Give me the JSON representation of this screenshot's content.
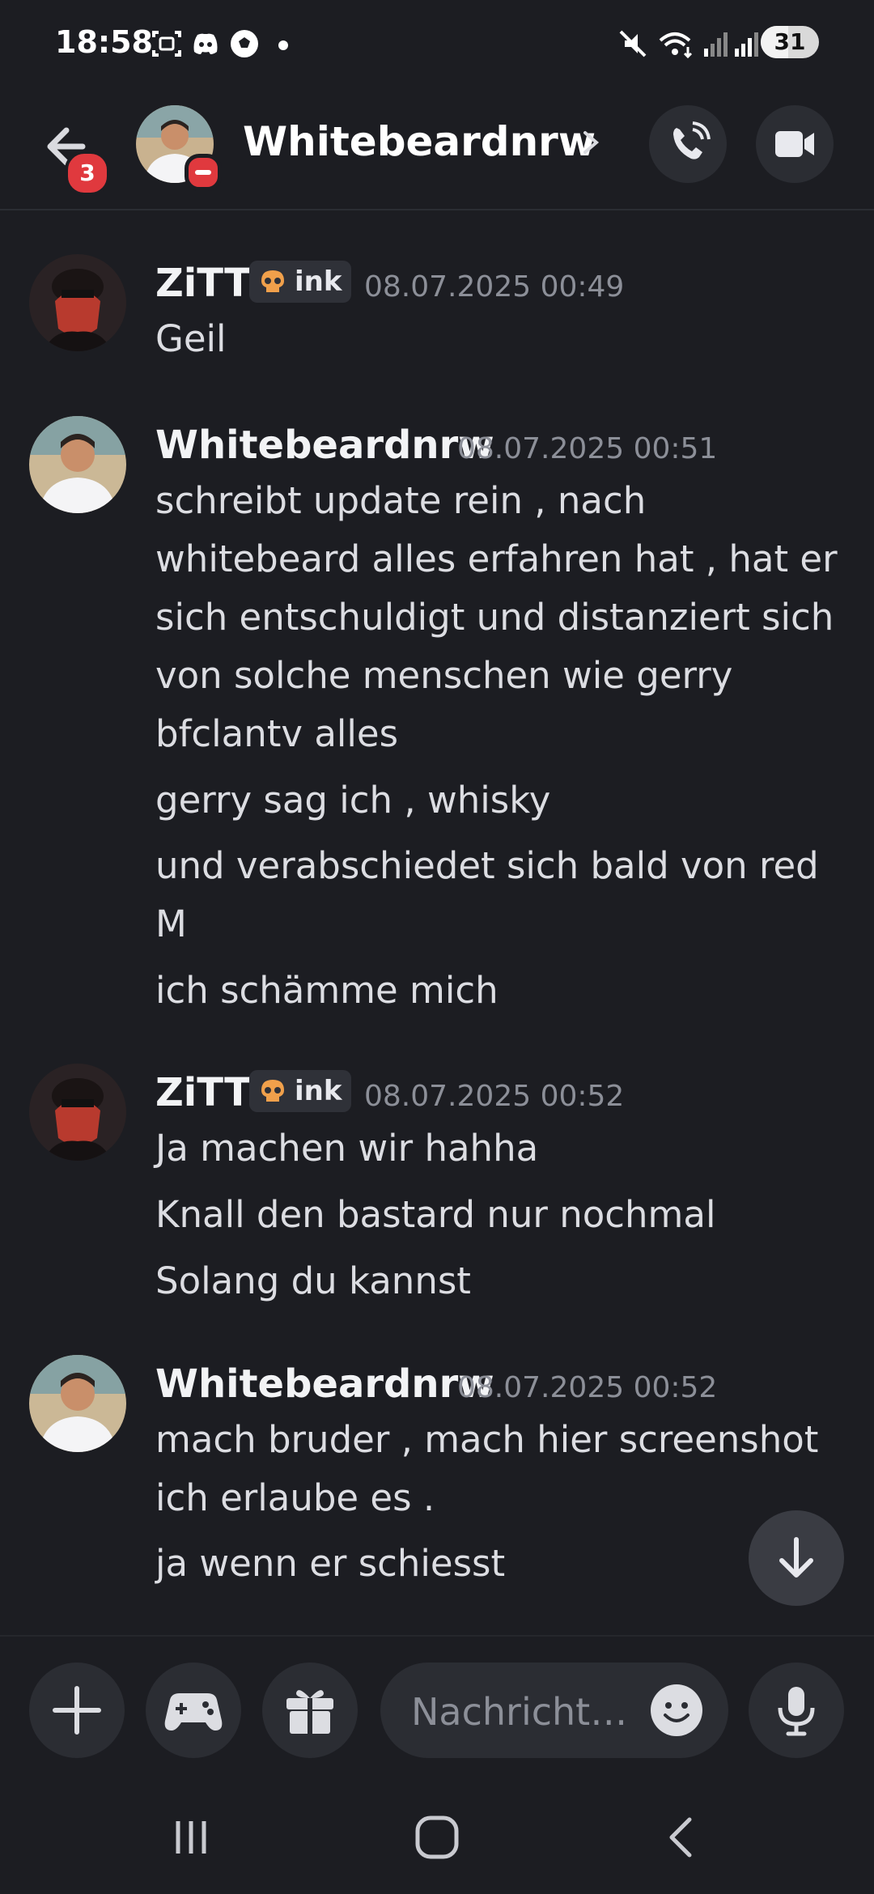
{
  "status_bar": {
    "time": "18:58",
    "battery": "31",
    "icons": [
      "screenshot-icon",
      "discord-icon",
      "football-icon",
      "notification-dot-icon",
      "mute-icon",
      "wifi-calling-icon",
      "signal-icon",
      "signal-icon-2"
    ]
  },
  "header": {
    "back_badge": "3",
    "title": "Whitebeardnrw",
    "chevron": "›",
    "buttons": [
      "call-icon",
      "video-icon"
    ]
  },
  "messages": [
    {
      "author": "ZiTT",
      "tag": "ink",
      "time": "08.07.2025 00:49",
      "lines": [
        "Geil"
      ]
    },
    {
      "author": "Whitebeardnrw",
      "time": "08.07.2025 00:51",
      "lines": [
        "schreibt update rein , nach",
        "whitebeard alles erfahren hat , hat er",
        "sich entschuldigt und distanziert sich",
        "von solche menschen wie gerry",
        "bfclantv alles",
        "gerry sag ich , whisky",
        "und verabschiedet sich bald von red",
        "M",
        "ich schämme mich"
      ]
    },
    {
      "author": "ZiTT",
      "tag": "ink",
      "time": "08.07.2025 00:52",
      "lines": [
        "Ja machen wir hahha",
        "Knall den bastard nur nochmal",
        "Solang du kannst"
      ]
    },
    {
      "author": "Whitebeardnrw",
      "time": "08.07.2025 00:52",
      "lines": [
        "mach bruder , mach hier screenshot",
        "ich erlaube es .",
        "ja wenn er schiesst"
      ]
    }
  ],
  "composer": {
    "placeholder": "Nachricht…",
    "buttons": [
      "plus-icon",
      "gamepad-icon",
      "gift-icon",
      "emoji-icon",
      "microphone-icon"
    ]
  },
  "nav_bar": {
    "buttons": [
      "recent-apps-icon",
      "home-icon",
      "back-nav-icon"
    ]
  },
  "colors": {
    "background": "#1c1d22",
    "surface": "#2b2d33",
    "text": "#dcdde2",
    "muted": "#8c8f98",
    "danger": "#e0393e"
  }
}
